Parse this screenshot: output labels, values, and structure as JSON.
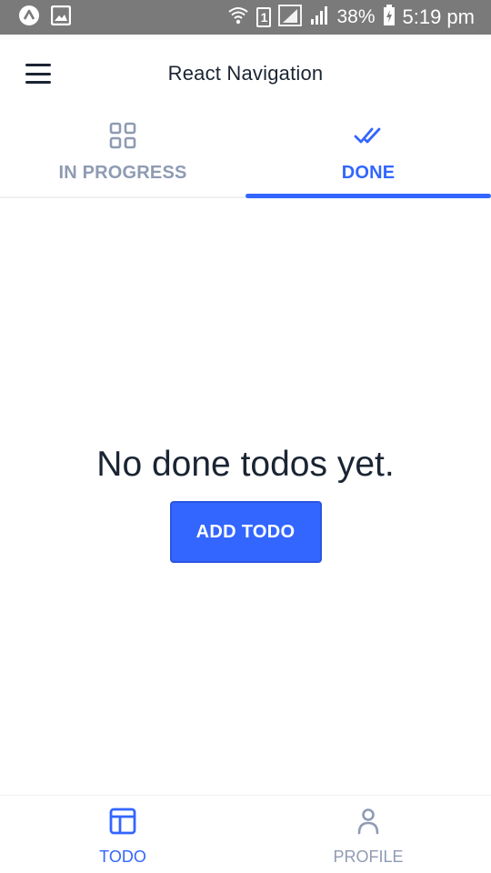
{
  "status_bar": {
    "battery": "38%",
    "time": "5:19 pm",
    "sim_slot": "1"
  },
  "header": {
    "title": "React Navigation"
  },
  "top_tabs": [
    {
      "label": "IN PROGRESS",
      "icon": "grid-icon",
      "active": false
    },
    {
      "label": "DONE",
      "icon": "done-all-icon",
      "active": true
    }
  ],
  "content": {
    "empty_message": "No done todos yet.",
    "add_button_label": "ADD TODO"
  },
  "bottom_tabs": [
    {
      "label": "TODO",
      "icon": "layout-icon",
      "active": true
    },
    {
      "label": "PROFILE",
      "icon": "person-icon",
      "active": false
    }
  ],
  "colors": {
    "accent": "#3366ff",
    "inactive": "#8f9bb3",
    "text": "#1a2433",
    "status_bar": "#7a7a7a"
  }
}
